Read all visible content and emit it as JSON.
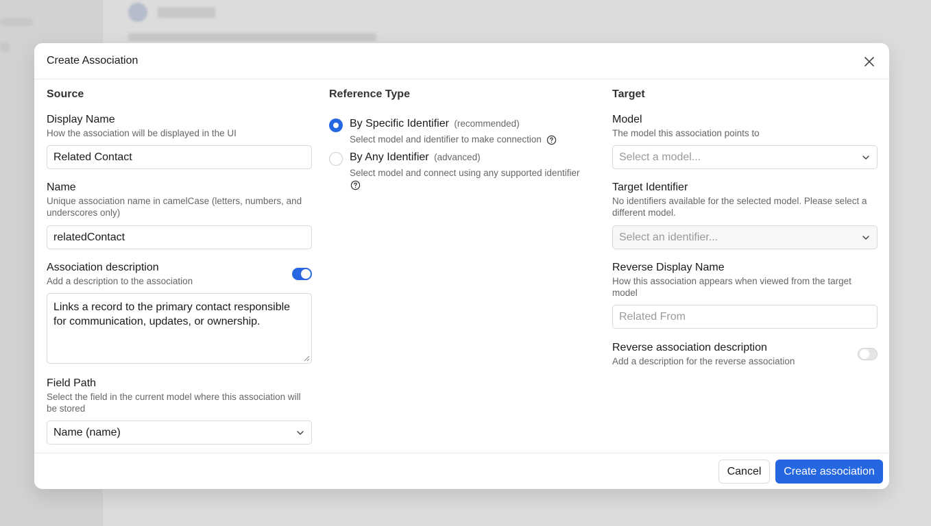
{
  "modal": {
    "title": "Create Association",
    "close_icon": "close-icon"
  },
  "source": {
    "section_title": "Source",
    "display_name": {
      "label": "Display Name",
      "help": "How the association will be displayed in the UI",
      "value": "Related Contact"
    },
    "name": {
      "label": "Name",
      "help": "Unique association name in camelCase (letters, numbers, and underscores only)",
      "value": "relatedContact"
    },
    "description": {
      "label": "Association description",
      "help": "Add a description to the association",
      "toggle_on": true,
      "value": "Links a record to the primary contact responsible for communication, updates, or ownership."
    },
    "field_path": {
      "label": "Field Path",
      "help": "Select the field in the current model where this association will be stored",
      "value": "Name (name)"
    }
  },
  "reference_type": {
    "section_title": "Reference Type",
    "options": [
      {
        "label": "By Specific Identifier",
        "hint": "(recommended)",
        "help": "Select model and identifier to make connection",
        "selected": true
      },
      {
        "label": "By Any Identifier",
        "hint": "(advanced)",
        "help": "Select model and connect using any supported identifier",
        "selected": false
      }
    ]
  },
  "target": {
    "section_title": "Target",
    "model": {
      "label": "Model",
      "help": "The model this association points to",
      "placeholder": "Select a model..."
    },
    "identifier": {
      "label": "Target Identifier",
      "help": "No identifiers available for the selected model. Please select a different model.",
      "placeholder": "Select an identifier..."
    },
    "reverse_display_name": {
      "label": "Reverse Display Name",
      "help": "How this association appears when viewed from the target model",
      "placeholder": "Related From"
    },
    "reverse_description": {
      "label": "Reverse association description",
      "help": "Add a description for the reverse association",
      "toggle_on": false
    }
  },
  "footer": {
    "cancel_label": "Cancel",
    "create_label": "Create association"
  },
  "colors": {
    "accent": "#2467e0",
    "border": "#d9d9d9",
    "muted_text": "#666666"
  }
}
